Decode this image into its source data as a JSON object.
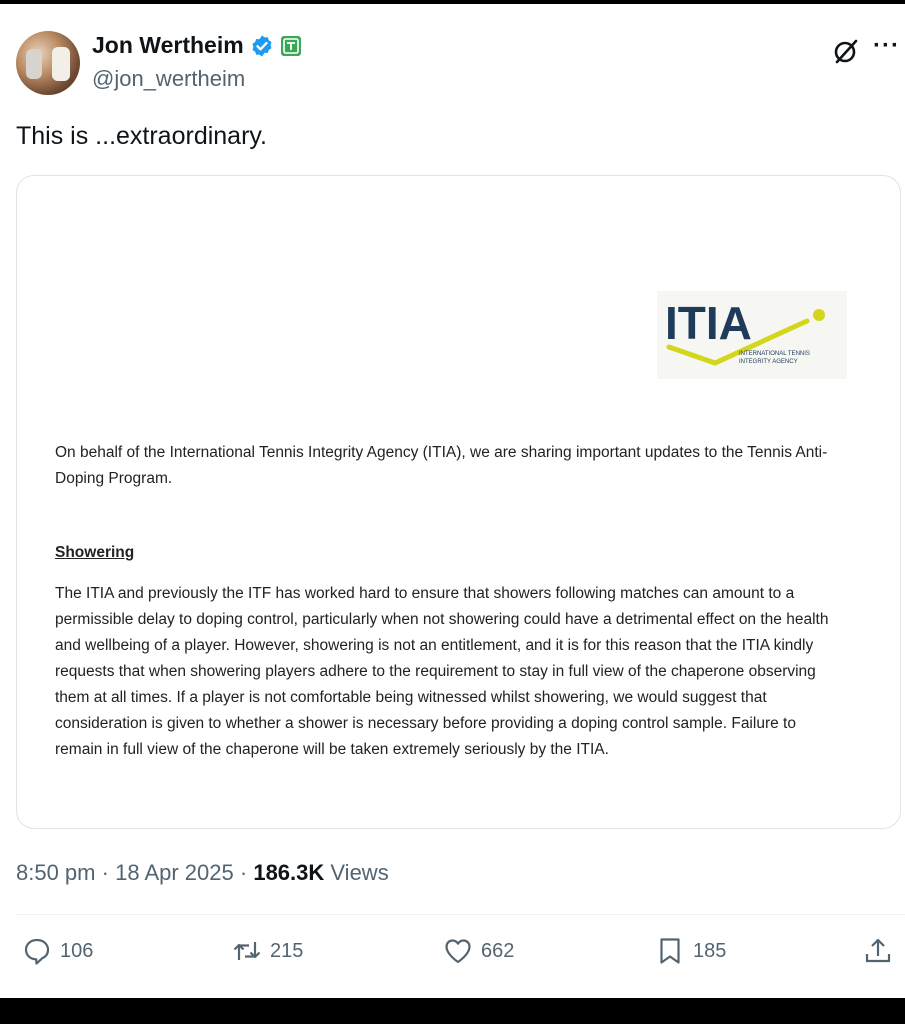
{
  "author": {
    "name": "Jon Wertheim",
    "handle": "@jon_wertheim",
    "verified_color": "#1d9bf0",
    "affiliate_color": "#3aa856"
  },
  "tweet": {
    "text": "This is ...extraordinary."
  },
  "card": {
    "logo_text": "ITIA",
    "logo_sub_line1": "INTERNATIONAL TENNIS",
    "logo_sub_line2": "INTEGRITY AGENCY",
    "intro": "On behalf of the International Tennis Integrity Agency (ITIA), we are sharing important updates to the Tennis Anti-Doping Program.",
    "heading": "Showering",
    "body": "The ITIA and previously the ITF has worked hard to ensure that showers following matches can amount to a permissible delay to doping control, particularly when not showering could have a detrimental effect on the health and wellbeing of a player. However, showering is not an entitlement, and it is for this reason that the ITIA kindly requests that when showering players adhere to the requirement to stay in full view of the chaperone observing them at all times. If a player is not comfortable being witnessed whilst showering, we would suggest that consideration is given to whether a shower is necessary before providing a doping control sample. Failure to remain in full view of the chaperone will be taken extremely seriously by the ITIA."
  },
  "meta": {
    "time": "8:50 pm",
    "date": "18 Apr 2025",
    "views_count": "186.3K",
    "views_label": "Views"
  },
  "actions": {
    "replies": "106",
    "reposts": "215",
    "likes": "662",
    "bookmarks": "185"
  },
  "icons": {
    "reply": "reply-icon",
    "repost": "repost-icon",
    "like": "heart-icon",
    "bookmark": "bookmark-icon",
    "share": "share-icon",
    "grok": "grok-icon",
    "more": "more-icon"
  }
}
